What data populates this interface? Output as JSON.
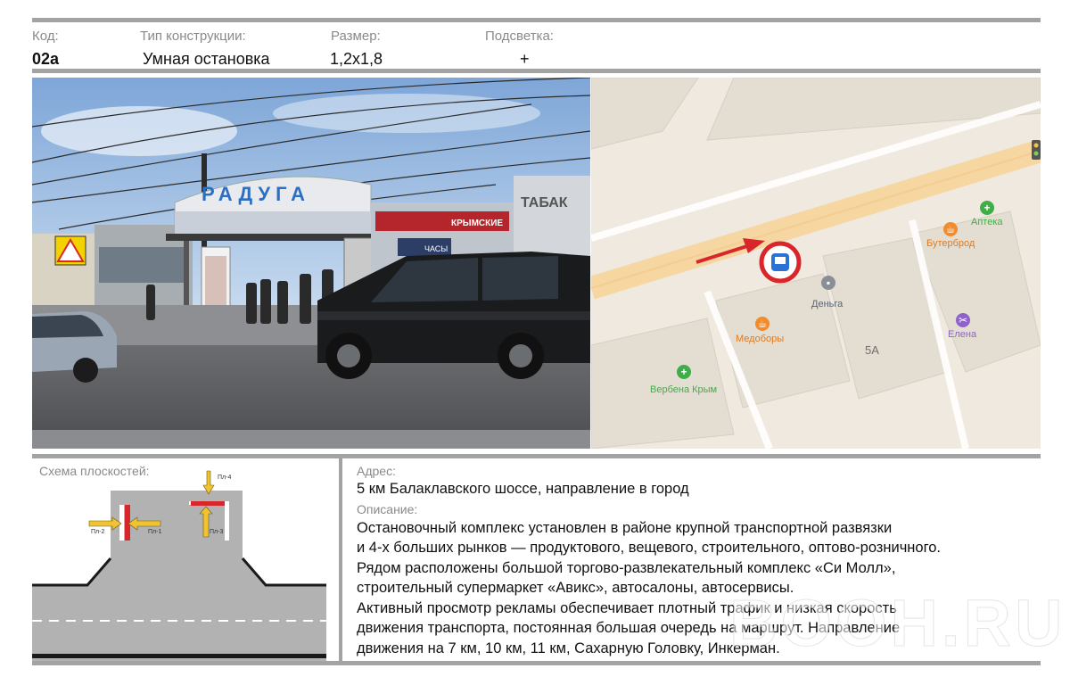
{
  "header": {
    "code_label": "Код:",
    "type_label": "Тип конструкции:",
    "size_label": "Размер:",
    "light_label": "Подсветка:",
    "code_value": "02а",
    "type_value": "Умная остановка",
    "size_value": "1,2х1,8",
    "light_value": "+"
  },
  "photo": {
    "sign_text": "РАДУГА",
    "shop_1": "КРЫМСКИЕ",
    "shop_2": "ТАБАК",
    "shop_3": "ЧАСЫ"
  },
  "map": {
    "poi_apteka": "Аптека",
    "poi_buterbrod": "Бутерброд",
    "poi_denga": "Деньга",
    "poi_medobory": "Медоборы",
    "poi_elena": "Елена",
    "poi_verbena": "Вербена Крым",
    "building_5a": "5А"
  },
  "scheme": {
    "title": "Схема плоскостей:",
    "pl1": "Пл-1",
    "pl2": "Пл-2",
    "pl3": "Пл-3",
    "pl4": "Пл-4"
  },
  "address": {
    "label": "Адрес:",
    "value": "5 км Балаклавского шоссе, направление в город"
  },
  "description": {
    "label": "Описание:",
    "lines": [
      "Остановочный комплекс установлен в районе крупной транспортной развязки",
      "и 4-х больших рынков — продуктового, вещевого, строительного, оптово-розничного.",
      "Рядом расположены большой торгово-развлекательный комплекс «Си Молл»,",
      "строительный супермаркет «Авикс», автосалоны, автосервисы.",
      "Активный просмотр рекламы обеспечивает плотный трафик и низкая скорость",
      "движения транспорта, постоянная большая очередь на маршрут. Направление",
      "движения на 7 км, 10 км, 11 км, Сахарную Головку, Инкерман."
    ]
  },
  "watermark": "BOOH.RU",
  "colors": {
    "accent_red": "#d8262b",
    "rule_gray": "#a3a3a3",
    "plane_yellow": "#f1c232"
  }
}
